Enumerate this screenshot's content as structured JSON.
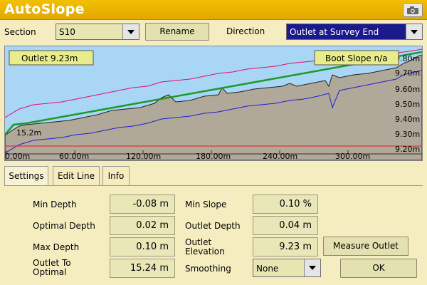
{
  "app": {
    "title": "AutoSlope"
  },
  "toolbar": {
    "section_label": "Section",
    "section_value": "S10",
    "rename_label": "Rename",
    "direction_label": "Direction",
    "direction_value": "Outlet at Survey End"
  },
  "plot": {
    "outlet_label": "Outlet 9.23m",
    "boot_slope_label": "Boot Slope n/a",
    "start_annotation": "15.2m",
    "x_ticks": [
      "0.00m",
      "60.00m",
      "120.00m",
      "180.00m",
      "240.00m",
      "300.00m"
    ],
    "y_ticks": [
      "9.80m",
      "9.70m",
      "9.60m",
      "9.50m",
      "9.40m",
      "9.30m",
      "9.20m"
    ]
  },
  "tabs": [
    {
      "label": "Settings",
      "active": true
    },
    {
      "label": "Edit Line",
      "active": false
    },
    {
      "label": "Info",
      "active": false
    }
  ],
  "settings": {
    "min_depth_label": "Min Depth",
    "min_depth_value": "-0.08 m",
    "optimal_depth_label": "Optimal Depth",
    "optimal_depth_value": "0.02 m",
    "max_depth_label": "Max Depth",
    "max_depth_value": "0.10 m",
    "outlet_to_optimal_label_1": "Outlet To",
    "outlet_to_optimal_label_2": "Optimal",
    "outlet_to_optimal_value": "15.24 m",
    "min_slope_label": "Min Slope",
    "min_slope_value": "0.10 %",
    "outlet_depth_label": "Outlet Depth",
    "outlet_depth_value": "0.04 m",
    "outlet_elevation_label_1": "Outlet",
    "outlet_elevation_label_2": "Elevation",
    "outlet_elevation_value": "9.23 m",
    "smoothing_label": "Smoothing",
    "smoothing_value": "None",
    "measure_outlet_label": "Measure Outlet",
    "ok_label": "OK"
  },
  "colors": {
    "title_bar": "#e8b000",
    "sky": "#a9d6f5",
    "ground": "#b0a898",
    "slope_line": "#1a9a2a",
    "upper_bound": "#e0106a",
    "lower_bound": "#2020d0",
    "datum": "#e02020"
  }
}
